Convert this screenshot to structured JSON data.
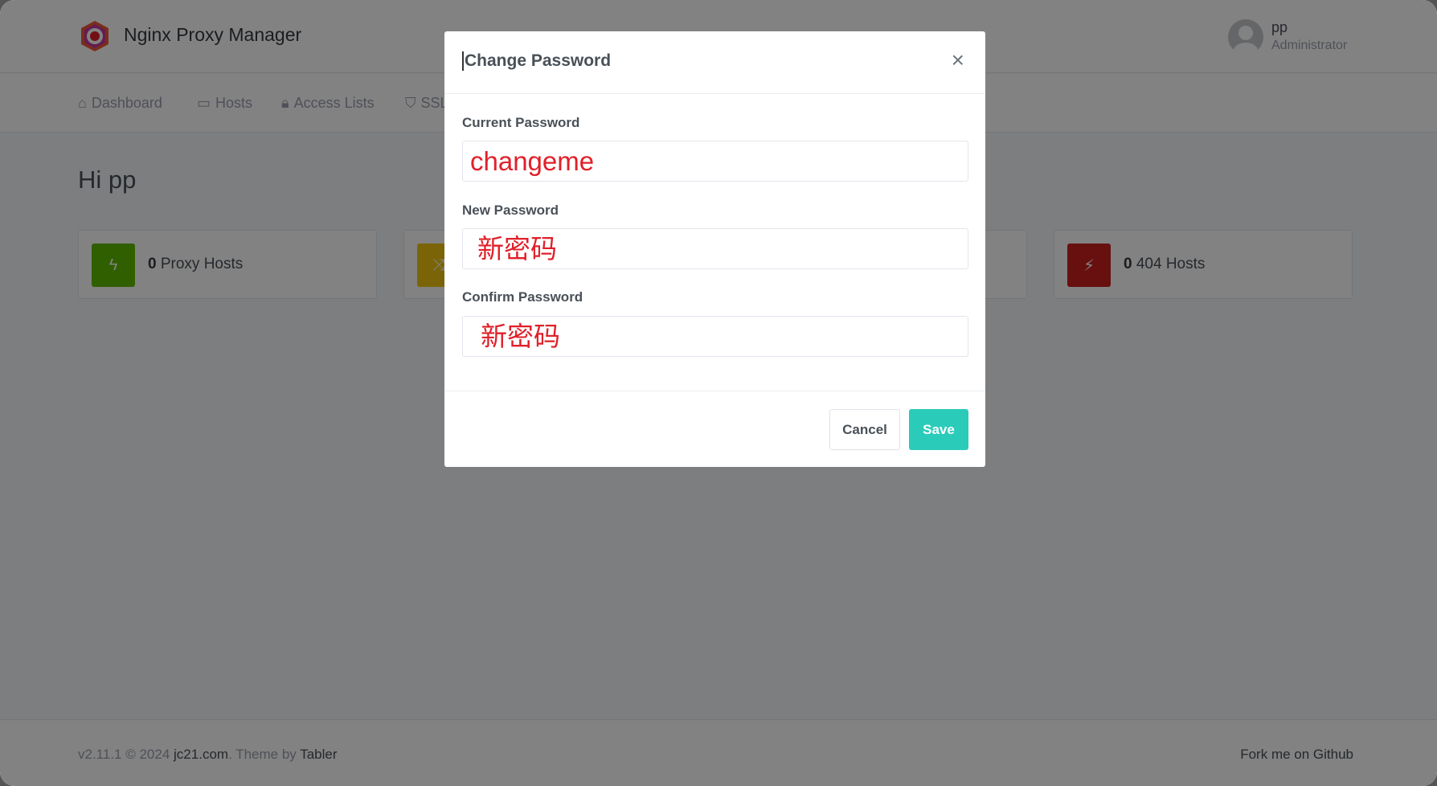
{
  "app": {
    "title": "Nginx Proxy Manager"
  },
  "user": {
    "name": "pp",
    "role": "Administrator"
  },
  "nav": [
    {
      "label": "Dashboard",
      "icon": "home-icon"
    },
    {
      "label": "Hosts",
      "icon": "monitor-icon"
    },
    {
      "label": "Access Lists",
      "icon": "lock-icon"
    },
    {
      "label": "SSL",
      "icon": "shield-icon"
    }
  ],
  "greeting": "Hi pp",
  "cards": [
    {
      "count": "0",
      "label": "Proxy Hosts",
      "color": "#5eba00",
      "icon": "zap-icon"
    },
    {
      "count": "",
      "label": "",
      "color": "#f1c40f",
      "icon": "shuffle-icon"
    },
    {
      "count": "",
      "label": "",
      "color": "#ffffff",
      "icon": ""
    },
    {
      "count": "0",
      "label": "404 Hosts",
      "color": "#cd201f",
      "icon": "zap-off-icon"
    }
  ],
  "footer": {
    "version": "v2.11.1 © 2024 ",
    "site": "jc21.com",
    "theme_prefix": ". Theme by ",
    "theme": "Tabler",
    "fork": "Fork me on Github"
  },
  "modal": {
    "title": "Change Password",
    "fields": [
      {
        "label": "Current Password",
        "value": "changeme"
      },
      {
        "label": "New Password",
        "value": "新密码"
      },
      {
        "label": "Confirm Password",
        "value": "新密码"
      }
    ],
    "cancel": "Cancel",
    "save": "Save",
    "accent": "#2bcbba"
  }
}
